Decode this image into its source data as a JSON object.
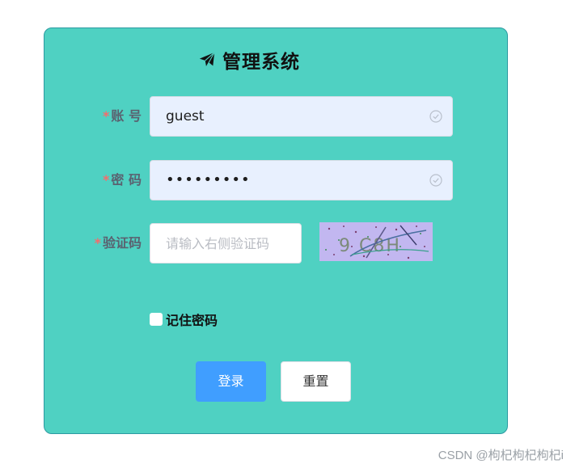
{
  "header": {
    "icon": "paper-plane-icon",
    "title": "管理系统"
  },
  "form": {
    "account": {
      "required_mark": "*",
      "label": "账 号",
      "value": "guest",
      "status_icon": "check-circle-icon"
    },
    "password": {
      "required_mark": "*",
      "label": "密 码",
      "value": "•••••••••",
      "status_icon": "check-circle-icon"
    },
    "captcha": {
      "required_mark": "*",
      "label": "验证码",
      "value": "",
      "placeholder": "请输入右侧验证码",
      "image_text": "9 C8H"
    },
    "remember": {
      "label": "记住密码",
      "checked": false
    },
    "buttons": {
      "login": "登录",
      "reset": "重置"
    }
  },
  "colors": {
    "card_background": "#4fd1c2",
    "input_filled_background": "#e8f0fe",
    "primary_button": "#409eff",
    "required_star": "#f56c6c",
    "captcha_background": "#c2b7f0"
  },
  "watermark": "CSDN @枸杞枸杞枸杞i"
}
